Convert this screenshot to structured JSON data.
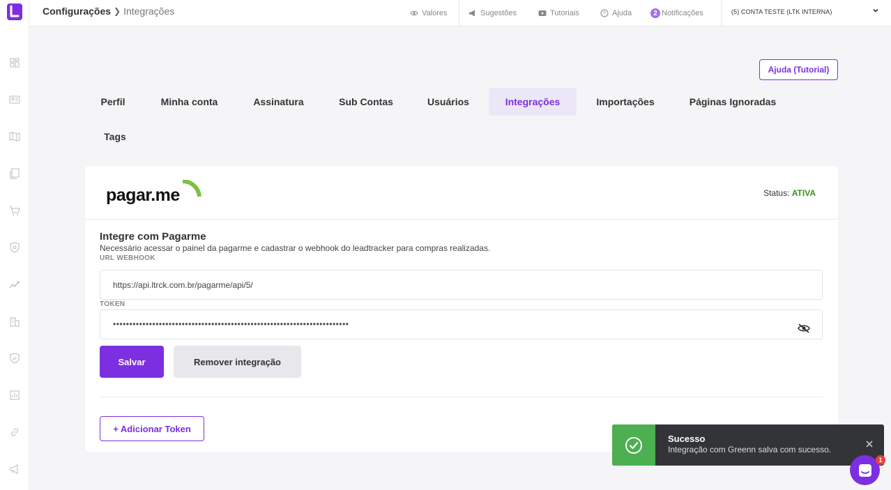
{
  "header": {
    "breadcrumb_section": "Configurações",
    "breadcrumb_current": "Integrações",
    "nav": {
      "valores": "Valores",
      "sugestoes": "Sugestões",
      "tutoriais": "Tutoriais",
      "ajuda": "Ajuda",
      "notificacoes": "Notificações",
      "notification_count": "2"
    },
    "account": "(5) CONTA TESTE (LTK INTERNA)"
  },
  "help_button": "Ajuda (Tutorial)",
  "tabs": [
    {
      "label": "Perfil"
    },
    {
      "label": "Minha conta"
    },
    {
      "label": "Assinatura"
    },
    {
      "label": "Sub Contas"
    },
    {
      "label": "Usuários"
    },
    {
      "label": "Integrações",
      "active": true
    },
    {
      "label": "Importações"
    },
    {
      "label": "Páginas Ignoradas"
    },
    {
      "label": "Tags"
    }
  ],
  "integration": {
    "brand": "pagar.me",
    "brand_color": "#7cc142",
    "status_label": "Status:",
    "status_value": "ATIVA",
    "title": "Integre com Pagarme",
    "description": "Necessário acessar o painel da pagarme e cadastrar o webhook do leadtracker para compras realizadas.",
    "webhook_label": "URL WEBHOOK",
    "webhook_value": "https://api.ltrck.com.br/pagarme/api/5/",
    "token_label": "TOKEN",
    "token_value": "••••••••••••••••••••••••••••••••••••••••••••••••••••••••••••••••••••••••",
    "save_label": "Salvar",
    "remove_label": "Remover integração",
    "add_token_label": "+ Adicionar Token"
  },
  "toast": {
    "title": "Sucesso",
    "message": "Integração com Greenn salva com sucesso.",
    "color": "#4caf50"
  },
  "chat": {
    "badge": "1"
  },
  "colors": {
    "accent": "#7b2fe0",
    "status_active": "#3a8f1e"
  }
}
